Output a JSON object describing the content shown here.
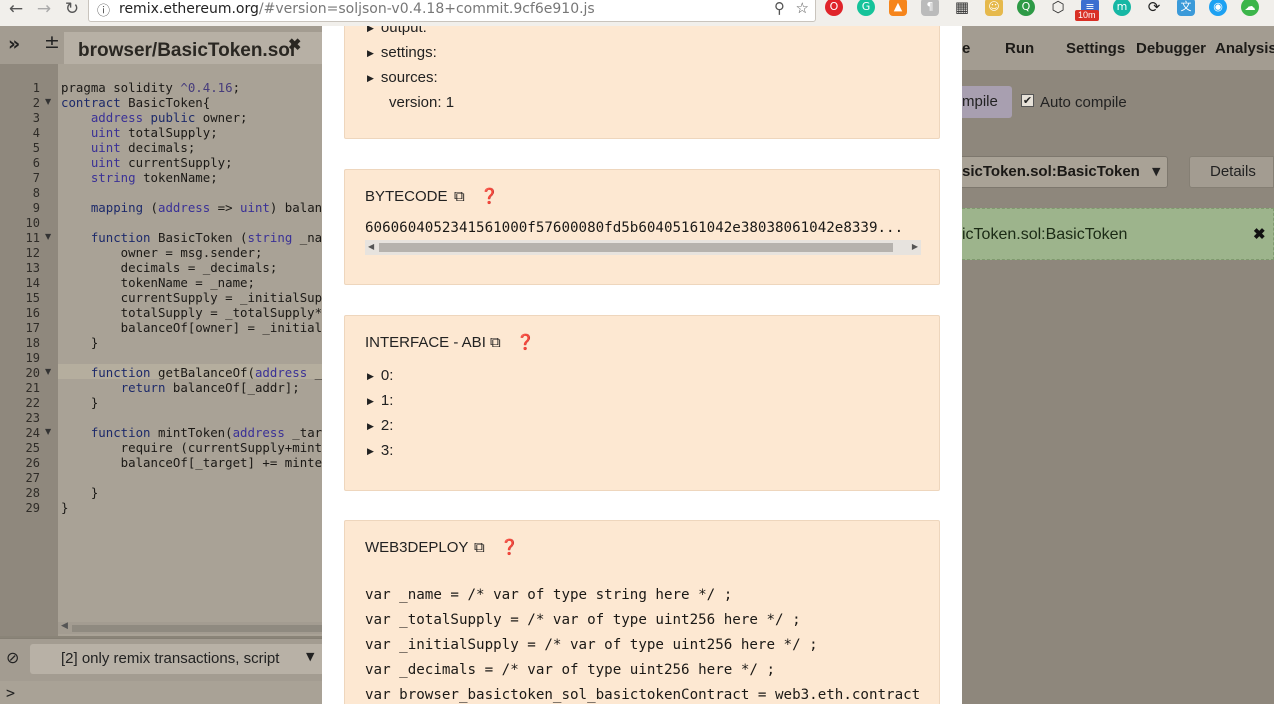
{
  "browser": {
    "url_host": "remix.ethereum.org",
    "url_rest": "/#version=soljson-v0.4.18+commit.9cf6e910.js",
    "ext_badge": "10m"
  },
  "editor": {
    "tab_label": "browser/BasicToken.sol",
    "line_numbers": [
      "1",
      "2",
      "3",
      "4",
      "5",
      "6",
      "7",
      "8",
      "9",
      "10",
      "11",
      "12",
      "13",
      "14",
      "15",
      "16",
      "17",
      "18",
      "19",
      "20",
      "21",
      "22",
      "23",
      "24",
      "25",
      "26",
      "27",
      "28",
      "29"
    ]
  },
  "terminal": {
    "filter_label": "[2] only remix transactions, script",
    "prompt": ">"
  },
  "right_panel": {
    "tabs": [
      "e",
      "Run",
      "Settings",
      "Debugger",
      "Analysis"
    ],
    "compile_label": "mpile",
    "auto_compile_label": "Auto compile",
    "contract_selected": "sicToken.sol:BasicToken",
    "details_label": "Details",
    "status_text": "icToken.sol:BasicToken"
  },
  "modal": {
    "metadata_items": [
      "output:",
      "settings:",
      "sources:"
    ],
    "metadata_version": "version: 1",
    "bytecode_title": "BYTECODE",
    "bytecode_value": "6060604052341561000f57600080fd5b60405161042e38038061042e8339...",
    "abi_title": "INTERFACE - ABI",
    "abi_items": [
      "0:",
      "1:",
      "2:",
      "3:"
    ],
    "web3_title": "WEB3DEPLOY",
    "web3_lines": [
      "var _name = /* var of type string here */ ;",
      "var _totalSupply = /* var of type uint256 here */ ;",
      "var _initialSupply = /* var of type uint256 here */ ;",
      "var _decimals = /* var of type uint256 here */ ;",
      "var browser_basictoken_sol_basictokenContract = web3.eth.contract("
    ]
  },
  "colors": {
    "modal_section_bg": "#fde8d2",
    "status_green": "#9db48c",
    "overlay_dim": "#8e877c"
  }
}
